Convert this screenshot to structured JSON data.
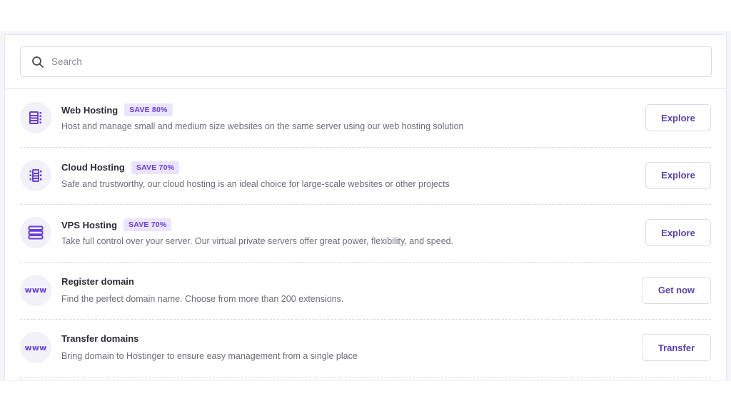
{
  "search": {
    "placeholder": "Search",
    "value": ""
  },
  "colors": {
    "accent": "#673de6",
    "badge_bg": "#ebe4ff",
    "button_text": "#5a3fb6"
  },
  "items": [
    {
      "icon": "web-hosting-server-icon",
      "title": "Web Hosting",
      "badge": "SAVE 80%",
      "description": "Host and manage small and medium size websites on the same server using our web hosting solution",
      "button": "Explore"
    },
    {
      "icon": "cloud-hosting-server-icon",
      "title": "Cloud Hosting",
      "badge": "SAVE 70%",
      "description": "Safe and trustworthy, our cloud hosting is an ideal choice for large-scale websites or other projects",
      "button": "Explore"
    },
    {
      "icon": "vps-server-stack-icon",
      "title": "VPS Hosting",
      "badge": "SAVE 70%",
      "description": "Take full control over your server. Our virtual private servers offer great power, flexibility, and speed.",
      "button": "Explore"
    },
    {
      "icon": "www-icon",
      "icon_text": "www",
      "title": "Register domain",
      "description": "Find the perfect domain name. Choose from more than 200 extensions.",
      "button": "Get now"
    },
    {
      "icon": "www-icon",
      "icon_text": "www",
      "title": "Transfer domains",
      "description": "Bring domain to Hostinger to ensure easy management from a single place",
      "button": "Transfer"
    }
  ]
}
